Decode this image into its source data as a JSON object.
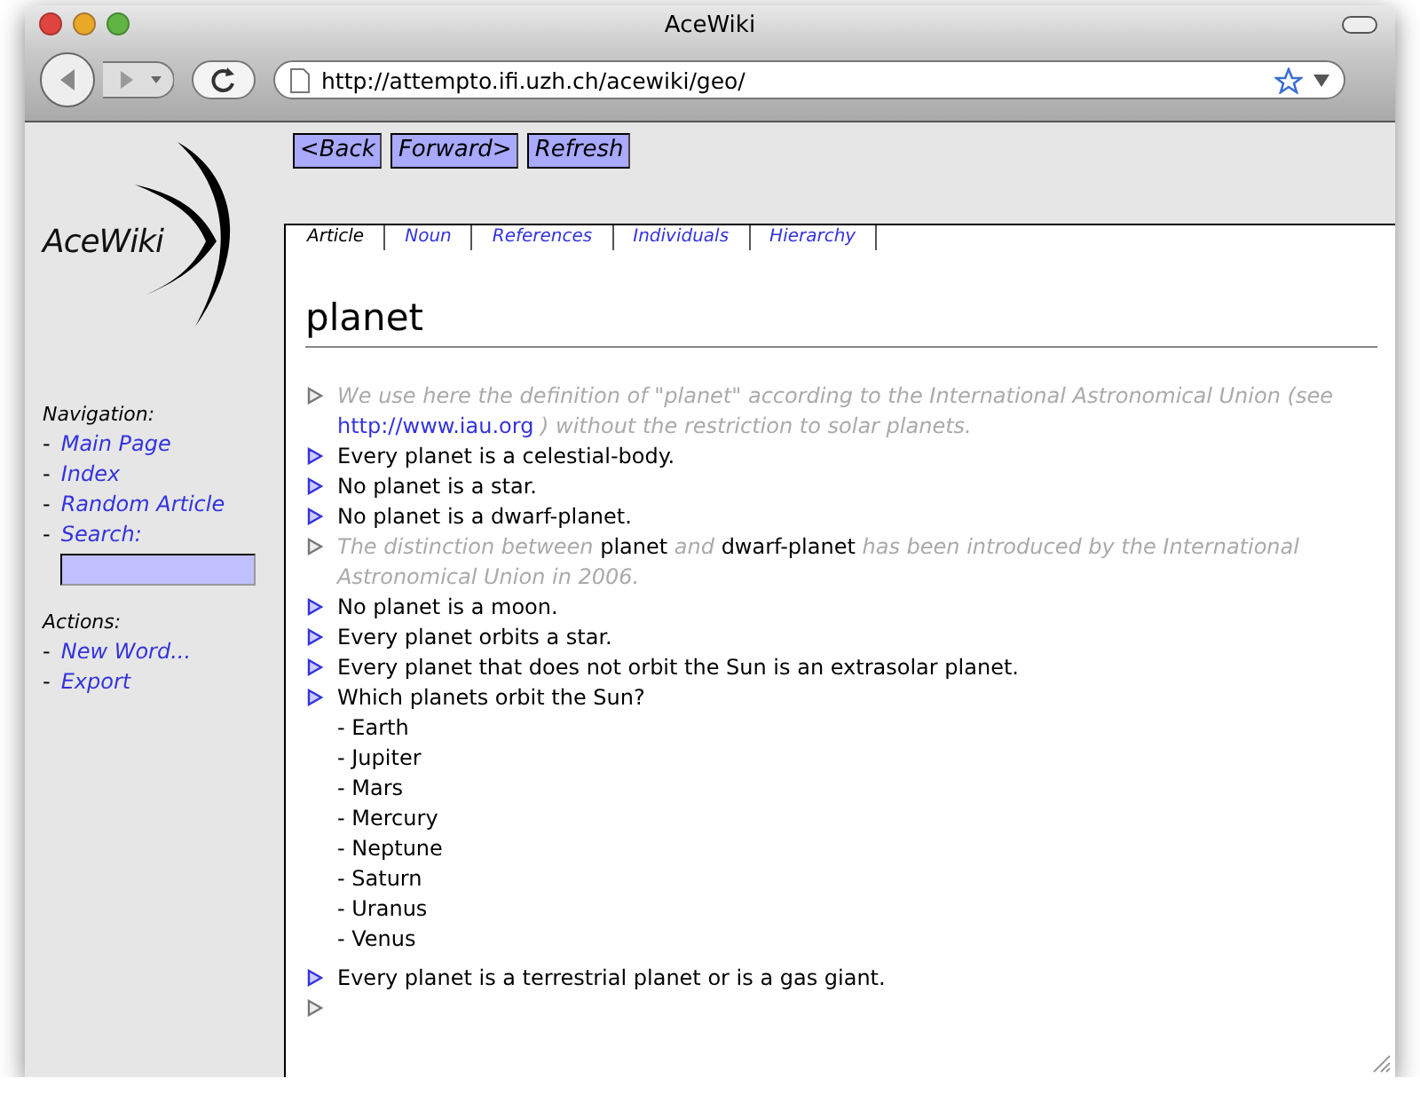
{
  "window": {
    "title": "AceWiki"
  },
  "toolbar": {
    "url": "http://attempto.ifi.uzh.ch/acewiki/geo/"
  },
  "nav_buttons": [
    "<Back",
    "Forward>",
    "Refresh"
  ],
  "sidebar": {
    "logo": "AceWiki",
    "sections": [
      {
        "heading": "Navigation:",
        "items": [
          {
            "kind": "link",
            "bullet": "-",
            "label": "Main Page"
          },
          {
            "kind": "link",
            "bullet": "-",
            "label": "Index"
          },
          {
            "kind": "link",
            "bullet": "-",
            "label": "Random Article"
          },
          {
            "kind": "search",
            "bullet": "-",
            "label": "Search:"
          }
        ]
      },
      {
        "heading": "Actions:",
        "items": [
          {
            "kind": "link",
            "bullet": "-",
            "label": "New Word..."
          },
          {
            "kind": "link",
            "bullet": "-",
            "label": "Export"
          }
        ]
      }
    ]
  },
  "tabs": [
    {
      "label": "Article",
      "selected": true
    },
    {
      "label": "Noun",
      "selected": false
    },
    {
      "label": "References",
      "selected": false
    },
    {
      "label": "Individuals",
      "selected": false
    },
    {
      "label": "Hierarchy",
      "selected": false
    }
  ],
  "article": {
    "title": "planet",
    "sentences": [
      {
        "kind": "comment",
        "parts": [
          {
            "kind": "text",
            "text": "We use here the definition of \"planet\" according to the International Astronomical Union (see "
          },
          {
            "kind": "link",
            "text": "http://www.iau.org"
          },
          {
            "kind": "text",
            "text": " ) without the restriction to solar planets."
          }
        ]
      },
      {
        "kind": "statement",
        "text": "Every planet is a celestial-body."
      },
      {
        "kind": "statement",
        "text": "No planet is a star."
      },
      {
        "kind": "statement",
        "text": "No planet is a dwarf-planet."
      },
      {
        "kind": "comment",
        "parts": [
          {
            "kind": "text",
            "text": "The distinction between "
          },
          {
            "kind": "word",
            "text": "planet"
          },
          {
            "kind": "text",
            "text": " and "
          },
          {
            "kind": "word",
            "text": "dwarf-planet"
          },
          {
            "kind": "text",
            "text": " has been introduced by the International Astronomical Union in 2006."
          }
        ]
      },
      {
        "kind": "statement",
        "text": "No planet is a moon."
      },
      {
        "kind": "statement",
        "text": "Every planet orbits a star."
      },
      {
        "kind": "statement",
        "text": "Every planet that does not orbit the Sun is an extrasolar planet."
      },
      {
        "kind": "question",
        "text": "Which planets orbit the Sun?",
        "answers": [
          "- Earth",
          "- Jupiter",
          "- Mars",
          "- Mercury",
          "- Neptune",
          "- Saturn",
          "- Uranus",
          "- Venus"
        ]
      },
      {
        "kind": "statement",
        "text": "Every planet is a terrestrial planet or is a gas giant."
      },
      {
        "kind": "empty"
      }
    ]
  }
}
